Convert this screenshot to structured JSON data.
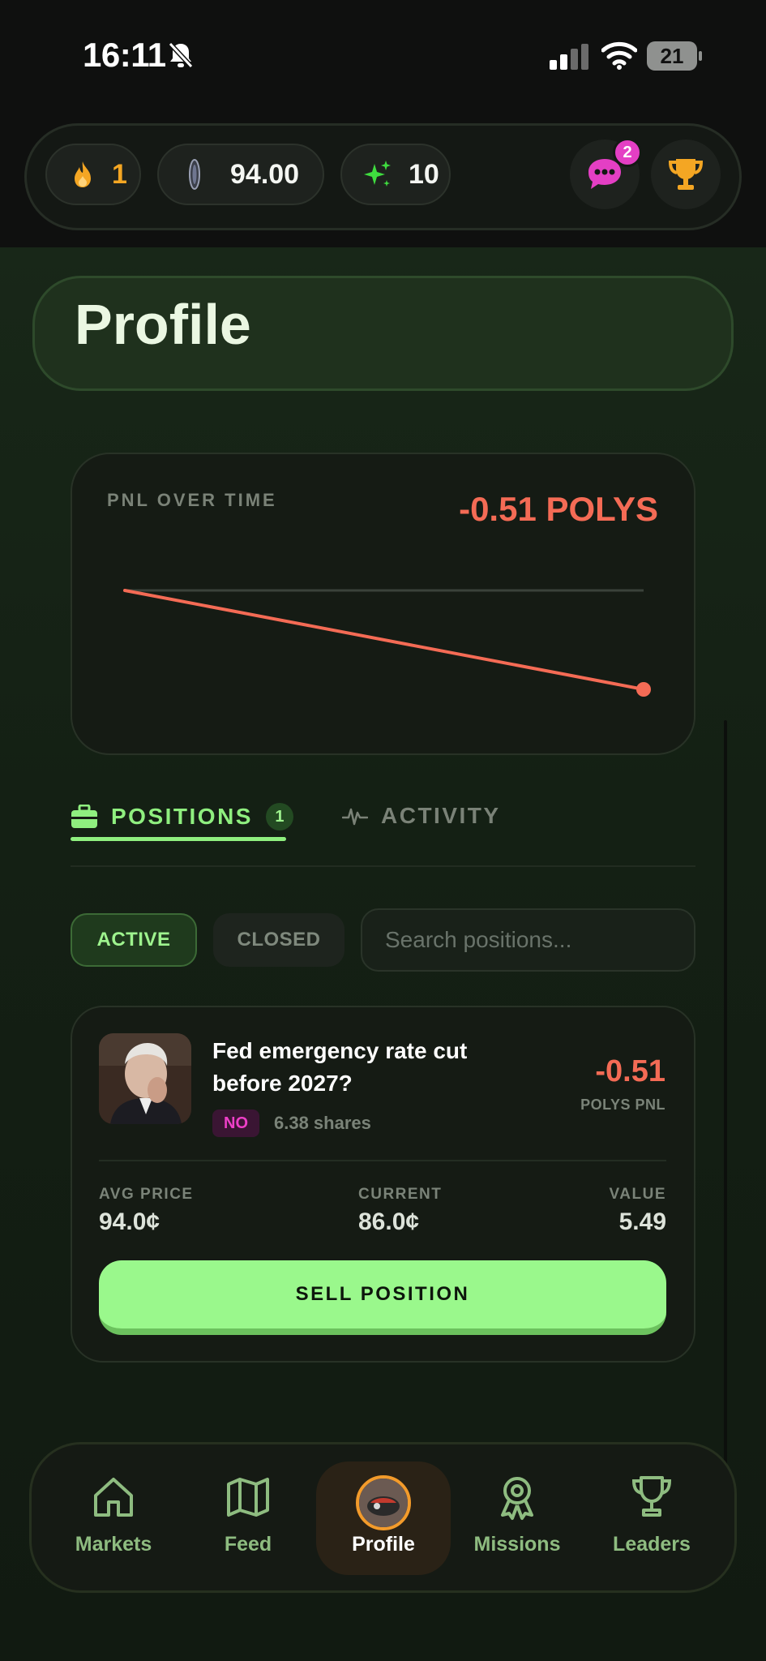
{
  "status_bar": {
    "time": "16:11",
    "battery": "21"
  },
  "top_bar": {
    "streak_count": "1",
    "balance": "94.00",
    "sparkles_count": "10",
    "messages_badge": "2",
    "icons": [
      "flame-icon",
      "coin-icon",
      "sparkles-icon",
      "chat-icon",
      "trophy-icon"
    ]
  },
  "page": {
    "title": "Profile"
  },
  "pnl_card": {
    "label": "PNL OVER TIME",
    "value": "-0.51 POLYS"
  },
  "chart_data": {
    "type": "line",
    "title": "PNL OVER TIME",
    "xlabel": "",
    "ylabel": "",
    "series": [
      {
        "values": [
          0,
          -0.51
        ]
      }
    ],
    "baseline": 0,
    "grid": false,
    "colors": {
      "line": "#f46b55",
      "baseline": "#3a423a"
    }
  },
  "tabs": [
    {
      "label": "POSITIONS",
      "count": "1",
      "active": true,
      "icon": "briefcase-icon"
    },
    {
      "label": "ACTIVITY",
      "active": false,
      "icon": "pulse-icon"
    }
  ],
  "filters": {
    "active_label": "ACTIVE",
    "closed_label": "CLOSED",
    "search_placeholder": "Search positions..."
  },
  "position": {
    "title": "Fed emergency rate cut before 2027?",
    "side": "NO",
    "shares": "6.38 shares",
    "pnl": "-0.51",
    "pnl_label": "POLYS PNL",
    "avg_price_label": "AVG PRICE",
    "avg_price": "94.0¢",
    "current_label": "CURRENT",
    "current": "86.0¢",
    "value_label": "VALUE",
    "value": "5.49",
    "sell_label": "SELL POSITION"
  },
  "nav": {
    "items": [
      {
        "label": "Markets",
        "icon": "home-icon"
      },
      {
        "label": "Feed",
        "icon": "map-icon"
      },
      {
        "label": "Profile",
        "icon": "avatar",
        "active": true
      },
      {
        "label": "Missions",
        "icon": "medal-icon"
      },
      {
        "label": "Leaders",
        "icon": "trophy-icon"
      }
    ]
  },
  "colors": {
    "accent": "#9af88c",
    "negative": "#f46b55",
    "badge": "#e43fc4",
    "background": "#121811"
  }
}
